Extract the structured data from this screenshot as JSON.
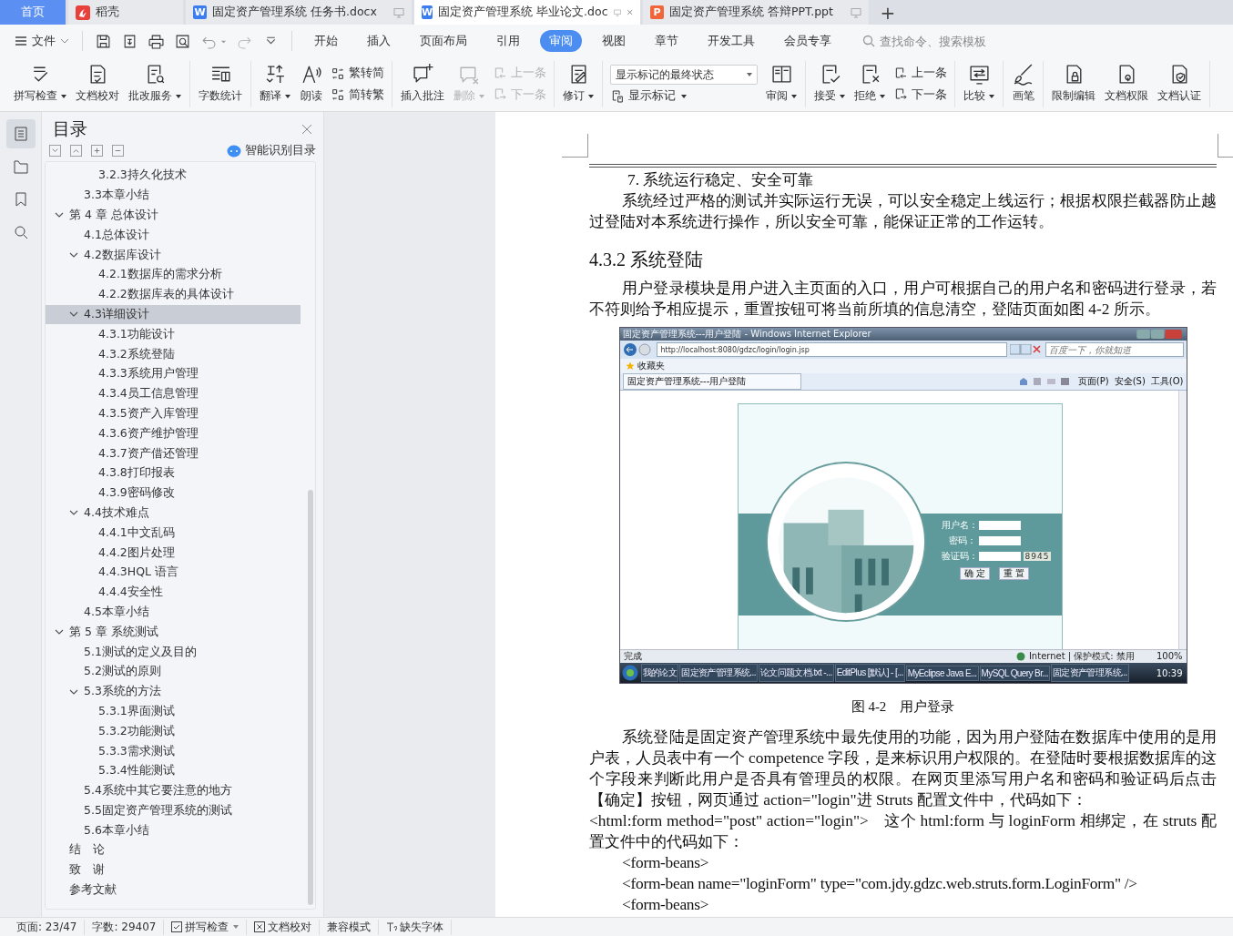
{
  "tabs": [
    {
      "kind": "home",
      "label": "首页",
      "selected": false
    },
    {
      "kind": "daoke",
      "label": "稻壳",
      "selected": false
    },
    {
      "kind": "word",
      "badge": "W",
      "label": "固定资产管理系统 任务书.docx",
      "selected": false
    },
    {
      "kind": "word",
      "badge": "W",
      "label": "固定资产管理系统 毕业论文.doc",
      "selected": true
    },
    {
      "kind": "ppt",
      "badge": "P",
      "label": "固定资产管理系统 答辩PPT.ppt",
      "selected": false
    }
  ],
  "new_tab": "+",
  "file_menu": "文件",
  "menu_tabs": [
    {
      "label": "开始",
      "selected": false
    },
    {
      "label": "插入",
      "selected": false
    },
    {
      "label": "页面布局",
      "selected": false
    },
    {
      "label": "引用",
      "selected": false
    },
    {
      "label": "审阅",
      "selected": true
    },
    {
      "label": "视图",
      "selected": false
    },
    {
      "label": "章节",
      "selected": false
    },
    {
      "label": "开发工具",
      "selected": false
    },
    {
      "label": "会员专享",
      "selected": false
    }
  ],
  "search": {
    "placeholder": "查找命令、搜索模板"
  },
  "ribbon": [
    {
      "items": [
        {
          "kind": "large",
          "label": "拼写检查",
          "dropdown": true,
          "disabled": false
        },
        {
          "kind": "large",
          "label": "文档校对",
          "dropdown": false,
          "disabled": false
        },
        {
          "kind": "large",
          "label": "批改服务",
          "dropdown": true,
          "disabled": false
        }
      ]
    },
    {
      "items": [
        {
          "kind": "large",
          "label": "字数统计",
          "dropdown": false,
          "disabled": false
        }
      ]
    },
    {
      "items": [
        {
          "kind": "large",
          "label": "翻译",
          "dropdown": true,
          "disabled": false
        },
        {
          "kind": "large",
          "label": "朗读",
          "dropdown": false,
          "disabled": false
        },
        {
          "kind": "stack",
          "rows": [
            {
              "kind": "small",
              "label": "繁转简",
              "dropdown": false,
              "disabled": false
            },
            {
              "kind": "small",
              "label": "简转繁",
              "dropdown": false,
              "disabled": false
            }
          ]
        }
      ]
    },
    {
      "items": [
        {
          "kind": "large",
          "label": "插入批注",
          "dropdown": false,
          "disabled": false
        },
        {
          "kind": "large",
          "label": "删除",
          "dropdown": true,
          "disabled": true
        },
        {
          "kind": "stack",
          "rows": [
            {
              "kind": "small",
              "label": "上一条",
              "dropdown": false,
              "disabled": true
            },
            {
              "kind": "small",
              "label": "下一条",
              "dropdown": false,
              "disabled": true
            }
          ]
        }
      ]
    },
    {
      "items": [
        {
          "kind": "large",
          "label": "修订",
          "dropdown": true,
          "disabled": false
        }
      ]
    },
    {
      "items": [
        {
          "kind": "stack",
          "rows": [
            {
              "kind": "select",
              "value": "显示标记的最终状态",
              "dropdown": true
            },
            {
              "kind": "small",
              "label": "显示标记",
              "dropdown": true,
              "disabled": false
            }
          ]
        },
        {
          "kind": "large",
          "label": "审阅",
          "dropdown": true,
          "disabled": false
        }
      ]
    },
    {
      "items": [
        {
          "kind": "large",
          "label": "接受",
          "dropdown": true,
          "disabled": false
        },
        {
          "kind": "large",
          "label": "拒绝",
          "dropdown": true,
          "disabled": false
        },
        {
          "kind": "stack",
          "rows": [
            {
              "kind": "small",
              "label": "上一条",
              "dropdown": false,
              "disabled": false
            },
            {
              "kind": "small",
              "label": "下一条",
              "dropdown": false,
              "disabled": false
            }
          ]
        }
      ]
    },
    {
      "items": [
        {
          "kind": "large",
          "label": "比较",
          "dropdown": true,
          "disabled": false
        }
      ]
    },
    {
      "items": [
        {
          "kind": "large",
          "label": "画笔",
          "dropdown": false,
          "disabled": false
        }
      ]
    },
    {
      "items": [
        {
          "kind": "large",
          "label": "限制编辑",
          "dropdown": false,
          "disabled": false
        },
        {
          "kind": "large",
          "label": "文档权限",
          "dropdown": false,
          "disabled": false
        },
        {
          "kind": "large",
          "label": "文档认证",
          "dropdown": false,
          "disabled": false
        }
      ]
    }
  ],
  "nav_icons": [
    {
      "selected": true
    },
    {
      "selected": false
    },
    {
      "selected": false
    },
    {
      "selected": false
    }
  ],
  "sidebar": {
    "title": "目录",
    "smart_toc": "智能识别目录"
  },
  "toc": [
    {
      "children": [
        {
          "children": [
            {
              "label": "3.2.3持久化技术",
              "selected": false
            }
          ]
        },
        {
          "label": "3.3本章小结",
          "selected": false
        }
      ]
    },
    {
      "label": "第 4 章  总体设计",
      "selected": false,
      "expanded": true,
      "children": [
        {
          "label": "4.1总体设计",
          "selected": false
        },
        {
          "label": "4.2数据库设计",
          "selected": false,
          "expanded": true,
          "children": [
            {
              "label": "4.2.1数据库的需求分析",
              "selected": false
            },
            {
              "label": "4.2.2数据库表的具体设计",
              "selected": false
            }
          ]
        },
        {
          "label": "4.3详细设计",
          "selected": true,
          "expanded": true,
          "children": [
            {
              "label": "4.3.1功能设计",
              "selected": false
            },
            {
              "label": "4.3.2系统登陆",
              "selected": false
            },
            {
              "label": "4.3.3系统用户管理",
              "selected": false
            },
            {
              "label": "4.3.4员工信息管理",
              "selected": false
            },
            {
              "label": "4.3.5资产入库管理",
              "selected": false
            },
            {
              "label": "4.3.6资产维护管理",
              "selected": false
            },
            {
              "label": "4.3.7资产借还管理",
              "selected": false
            },
            {
              "label": "4.3.8打印报表",
              "selected": false
            },
            {
              "label": "4.3.9密码修改",
              "selected": false
            }
          ]
        },
        {
          "label": "4.4技术难点",
          "selected": false,
          "expanded": true,
          "children": [
            {
              "label": "4.4.1中文乱码",
              "selected": false
            },
            {
              "label": "4.4.2图片处理",
              "selected": false
            },
            {
              "label": "4.4.3HQL 语言",
              "selected": false
            },
            {
              "label": "4.4.4安全性",
              "selected": false
            }
          ]
        },
        {
          "label": "4.5本章小结",
          "selected": false
        }
      ]
    },
    {
      "label": "第 5 章  系统测试",
      "selected": false,
      "expanded": true,
      "children": [
        {
          "label": "5.1测试的定义及目的",
          "selected": false
        },
        {
          "label": "5.2测试的原则",
          "selected": false
        },
        {
          "label": "5.3系统的方法",
          "selected": false,
          "expanded": true,
          "children": [
            {
              "label": "5.3.1界面测试",
              "selected": false
            },
            {
              "label": "5.3.2功能测试",
              "selected": false
            },
            {
              "label": "5.3.3需求测试",
              "selected": false
            },
            {
              "label": "5.3.4性能测试",
              "selected": false
            }
          ]
        },
        {
          "label": "5.4系统中其它要注意的地方",
          "selected": false
        },
        {
          "label": "5.5固定资产管理系统的测试",
          "selected": false
        },
        {
          "label": "5.6本章小结",
          "selected": false
        }
      ]
    },
    {
      "label": "结　论",
      "selected": false
    },
    {
      "label": "致　谢",
      "selected": false
    },
    {
      "label": "参考文献",
      "selected": false
    }
  ],
  "document": {
    "blocks": [
      {
        "kind": "item",
        "text": "7.  系统运行稳定、安全可靠"
      },
      {
        "kind": "para",
        "text": "系统经过严格的测试并实际运行无误，可以安全稳定上线运行；根据权限拦截器防止越过登陆对本系统进行操作，所以安全可靠，能保证正常的工作运转。"
      },
      {
        "kind": "heading",
        "text": "4.3.2  系统登陆"
      },
      {
        "kind": "para",
        "text": "用户登录模块是用户进入主页面的入口，用户可根据自己的用户名和密码进行登录，若不符则给予相应提示，重置按钮可将当前所填的信息清空，登陆页面如图 4-2 所示。"
      },
      {
        "kind": "figure",
        "window_title": "固定资产管理系统---用户登陆 - Windows Internet Explorer",
        "address": "http://localhost:8080/gdzc/login/login.jsp",
        "search_placeholder": "百度一下，你就知道",
        "favorites": "收藏夹",
        "page_tab": "固定资产管理系统---用户登陆",
        "commands": [
          "页面(P)",
          "安全(S)",
          "工具(O)"
        ],
        "login": {
          "fields": [
            {
              "label": "用户名："
            },
            {
              "label": "密码："
            },
            {
              "label": "验证码："
            }
          ],
          "captcha": "8945",
          "buttons": [
            "确 定",
            "重 置"
          ]
        },
        "status": "完成",
        "zone": "Internet | 保护模式: 禁用",
        "zoom": "100%",
        "taskbar": [
          "我的论文",
          "固定资产管理系统...",
          "论文问题文档.txt -...",
          "EditPlus [默认] - [...",
          "MyEclipse Java E...",
          "MySQL Query Br...",
          "固定资产管理系统..."
        ],
        "clock": "10:39"
      },
      {
        "kind": "caption",
        "text": "图 4-2　用户登录"
      },
      {
        "kind": "para",
        "text": "系统登陆是固定资产管理系统中最先使用的功能，因为用户登陆在数据库中使用的是用户表，人员表中有一个 competence 字段，是来标识用户权限的。在登陆时要根据数据库的这个字段来判断此用户是否具有管理员的权限。在网页里添写用户名和密码和验证码后点击【确定】按钮，网页通过 action=\"login\"进 Struts 配置文件中，代码如下："
      },
      {
        "kind": "plain",
        "text": "<html:form method=\"post\" action=\"login\">　这个 html:form 与 loginForm 相绑定，在 struts 配置文件中的代码如下："
      },
      {
        "kind": "code",
        "text": "<form-beans>"
      },
      {
        "kind": "code",
        "text": "<form-bean name=\"loginForm\" type=\"com.jdy.gdzc.web.struts.form.LoginForm\" />"
      },
      {
        "kind": "code",
        "text": "<form-beans>"
      }
    ]
  },
  "status_bar": [
    {
      "kind": "text",
      "label": "页面: 23/47"
    },
    {
      "kind": "text",
      "label": "字数: 29407"
    },
    {
      "kind": "check",
      "label": "拼写检查",
      "dropdown": true
    },
    {
      "kind": "box",
      "label": "文档校对",
      "dropdown": false
    },
    {
      "kind": "text",
      "label": "兼容模式"
    },
    {
      "kind": "font",
      "label": "缺失字体",
      "dropdown": false
    }
  ]
}
